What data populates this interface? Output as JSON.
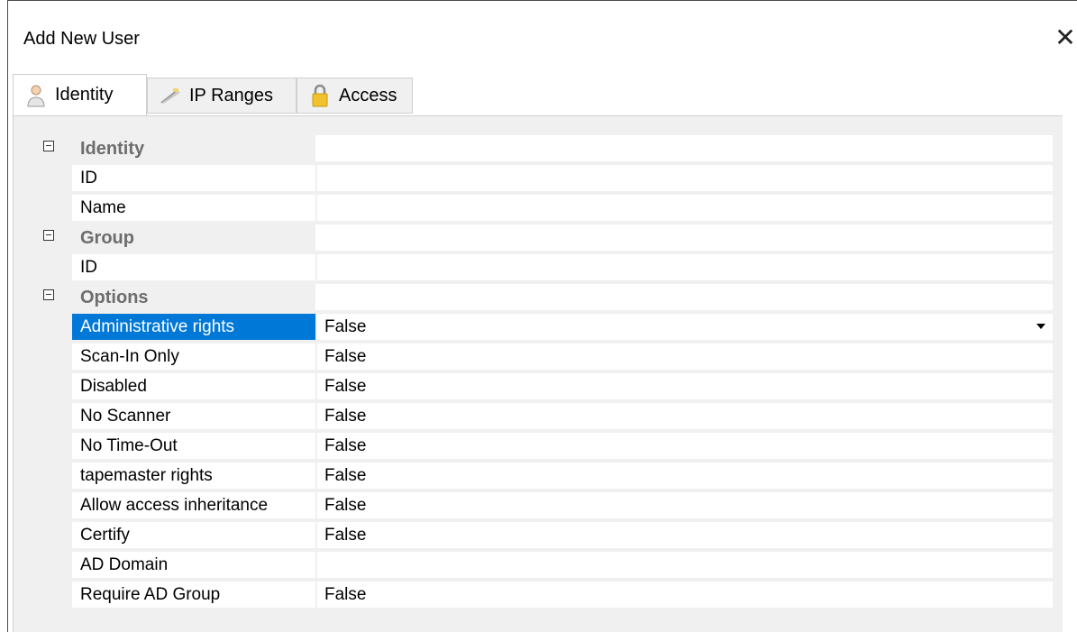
{
  "window": {
    "title": "Add New User"
  },
  "tabs": [
    {
      "label": "Identity",
      "icon": "user-icon"
    },
    {
      "label": "IP Ranges",
      "icon": "network-icon"
    },
    {
      "label": "Access",
      "icon": "lock-icon"
    }
  ],
  "grid": {
    "rows": [
      {
        "type": "category",
        "label": "Identity"
      },
      {
        "type": "property",
        "name": "ID",
        "value": ""
      },
      {
        "type": "property",
        "name": "Name",
        "value": ""
      },
      {
        "type": "category",
        "label": "Group"
      },
      {
        "type": "property",
        "name": "ID",
        "value": ""
      },
      {
        "type": "category",
        "label": "Options"
      },
      {
        "type": "property",
        "name": "Administrative rights",
        "value": "False",
        "selected": true
      },
      {
        "type": "property",
        "name": "Scan-In Only",
        "value": "False"
      },
      {
        "type": "property",
        "name": "Disabled",
        "value": "False"
      },
      {
        "type": "property",
        "name": "No Scanner",
        "value": "False"
      },
      {
        "type": "property",
        "name": "No Time-Out",
        "value": "False"
      },
      {
        "type": "property",
        "name": "tapemaster rights",
        "value": "False"
      },
      {
        "type": "property",
        "name": "Allow access inheritance",
        "value": "False"
      },
      {
        "type": "property",
        "name": "Certify",
        "value": "False"
      },
      {
        "type": "property",
        "name": "AD Domain",
        "value": ""
      },
      {
        "type": "property",
        "name": "Require AD Group",
        "value": "False"
      }
    ]
  },
  "colors": {
    "selection": "#0078d7",
    "panel": "#f0f0f0",
    "category_text": "#6d6d6d"
  }
}
